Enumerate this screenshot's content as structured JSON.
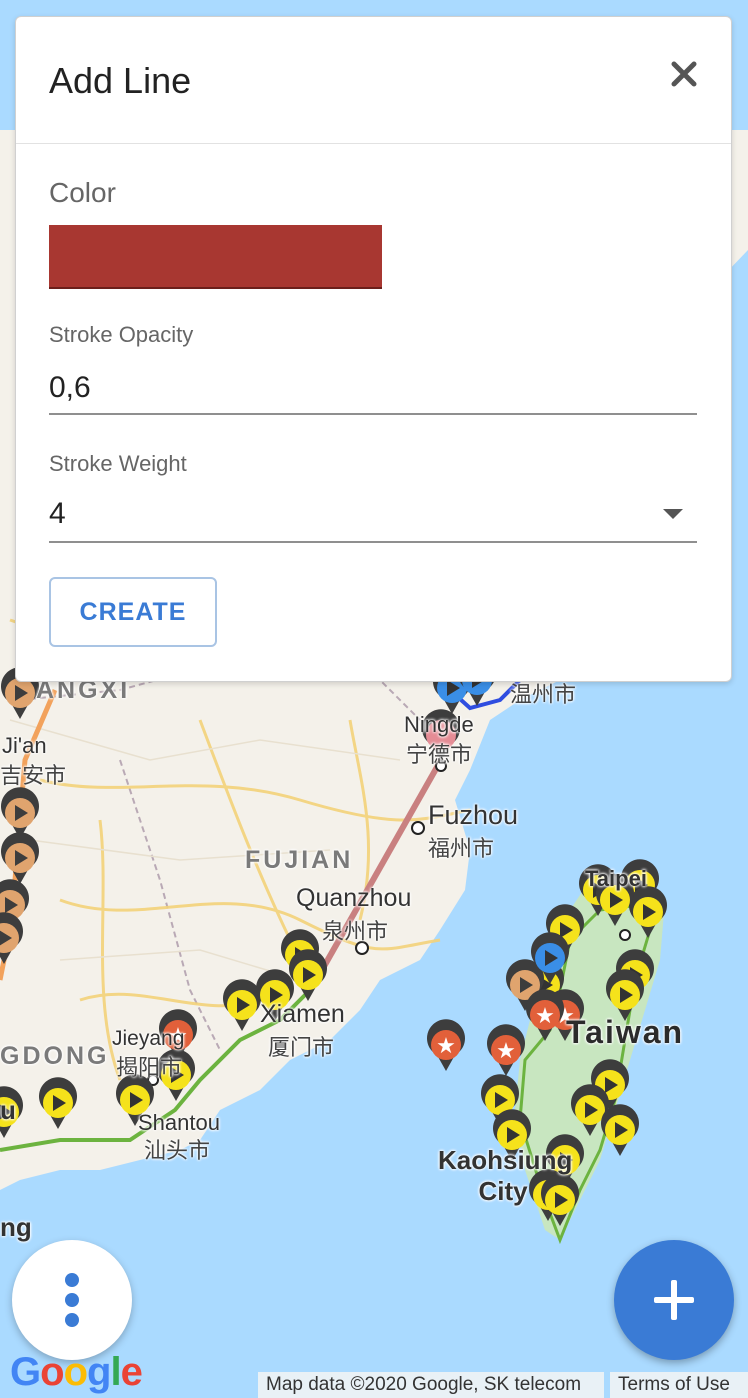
{
  "dialog": {
    "title": "Add Line",
    "color_label": "Color",
    "color_value": "#a83731",
    "stroke_opacity_label": "Stroke Opacity",
    "stroke_opacity_value": "0,6",
    "stroke_weight_label": "Stroke Weight",
    "stroke_weight_value": "4",
    "create_label": "CREATE",
    "close_icon": "close-icon"
  },
  "map": {
    "region_labels": [
      "ANGXI",
      "FUJIAN",
      "GDONG"
    ],
    "cities": [
      {
        "en": "Ji'an",
        "zh": "吉安市"
      },
      {
        "en": "Ningde",
        "zh": "宁德市"
      },
      {
        "en": "Fuzhou",
        "zh": "福州市"
      },
      {
        "en": "Quanzhou",
        "zh": "泉州市"
      },
      {
        "en": "Xiamen",
        "zh": "厦门市"
      },
      {
        "en": "Jieyang",
        "zh": "揭阳市"
      },
      {
        "en": "Shantou",
        "zh": "汕头市"
      },
      {
        "en": "Kaohsiung City",
        "zh": ""
      },
      {
        "en": "Taipei",
        "zh": ""
      }
    ],
    "wenzhou_zh": "温州市",
    "island_label": "Taiwan",
    "fragments": [
      "u",
      "ng",
      "n"
    ],
    "colors": {
      "water": "#aadaff",
      "land": "#f4f1ea",
      "route": "#6cb33f",
      "line": "#c98080",
      "marker_yellow": "#f5e21b"
    }
  },
  "fab": {
    "menu_icon": "more-vert-icon",
    "add_icon": "plus-icon"
  },
  "footer": {
    "google_logo": "Google",
    "attribution": "Map data ©2020 Google, SK telecom",
    "terms": "Terms of Use"
  }
}
